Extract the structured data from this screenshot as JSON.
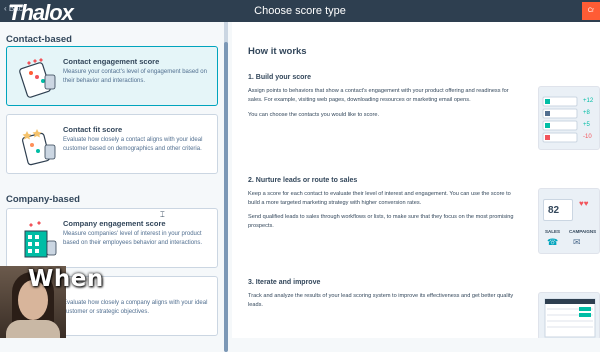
{
  "topbar": {
    "back_label": "Back",
    "logo": "Thalox",
    "title": "Choose score type",
    "cta_label": "Cr"
  },
  "left": {
    "contact_section": "Contact-based",
    "company_section": "Company-based",
    "cards": [
      {
        "title": "Contact engagement score",
        "desc": "Measure your contact's level of engagement based on their behavior and interactions.",
        "selected": true
      },
      {
        "title": "Contact fit score",
        "desc": "Evaluate how closely a contact aligns with your ideal customer based on demographics and other criteria.",
        "selected": false
      },
      {
        "title": "Company engagement score",
        "desc": "Measure companies' level of interest in your product based on their employees behavior and interactions.",
        "selected": false
      },
      {
        "title": "",
        "desc": "Evaluate how closely a company aligns with your ideal customer or strategic objectives.",
        "selected": false
      }
    ]
  },
  "right": {
    "heading": "How it works",
    "steps": [
      {
        "title": "1. Build your score",
        "paras": [
          "Assign points to behaviors that show a contact's engagement with your product offering and readiness for sales. For example, visiting web pages, downloading resources or marketing email opens.",
          "You can choose the contacts you would like to score."
        ]
      },
      {
        "title": "2. Nurture leads or route to sales",
        "paras": [
          "Keep a score for each contact to evaluate their level of interest and engagement. You can use the score to build a more targeted marketing strategy with higher conversion rates.",
          "Send qualified leads to sales through workflows or lists, to make sure that they focus on the most promising prospects."
        ]
      },
      {
        "title": "3. Iterate and improve",
        "paras": [
          "Track and analyze the results of your lead scoring system to improve its effectiveness and get better quality leads."
        ]
      }
    ],
    "illustration1": {
      "values": [
        "+12",
        "+8",
        "+5",
        "-10"
      ]
    },
    "illustration2": {
      "score": "82",
      "labels": [
        "SALES",
        "CAMPAIGNS"
      ]
    }
  },
  "overlay": {
    "caption": "When"
  },
  "colors": {
    "topbar": "#2e3f50",
    "accent": "#00a4bd",
    "cta": "#ff5c35",
    "selected_bg": "#e5f5f8"
  }
}
